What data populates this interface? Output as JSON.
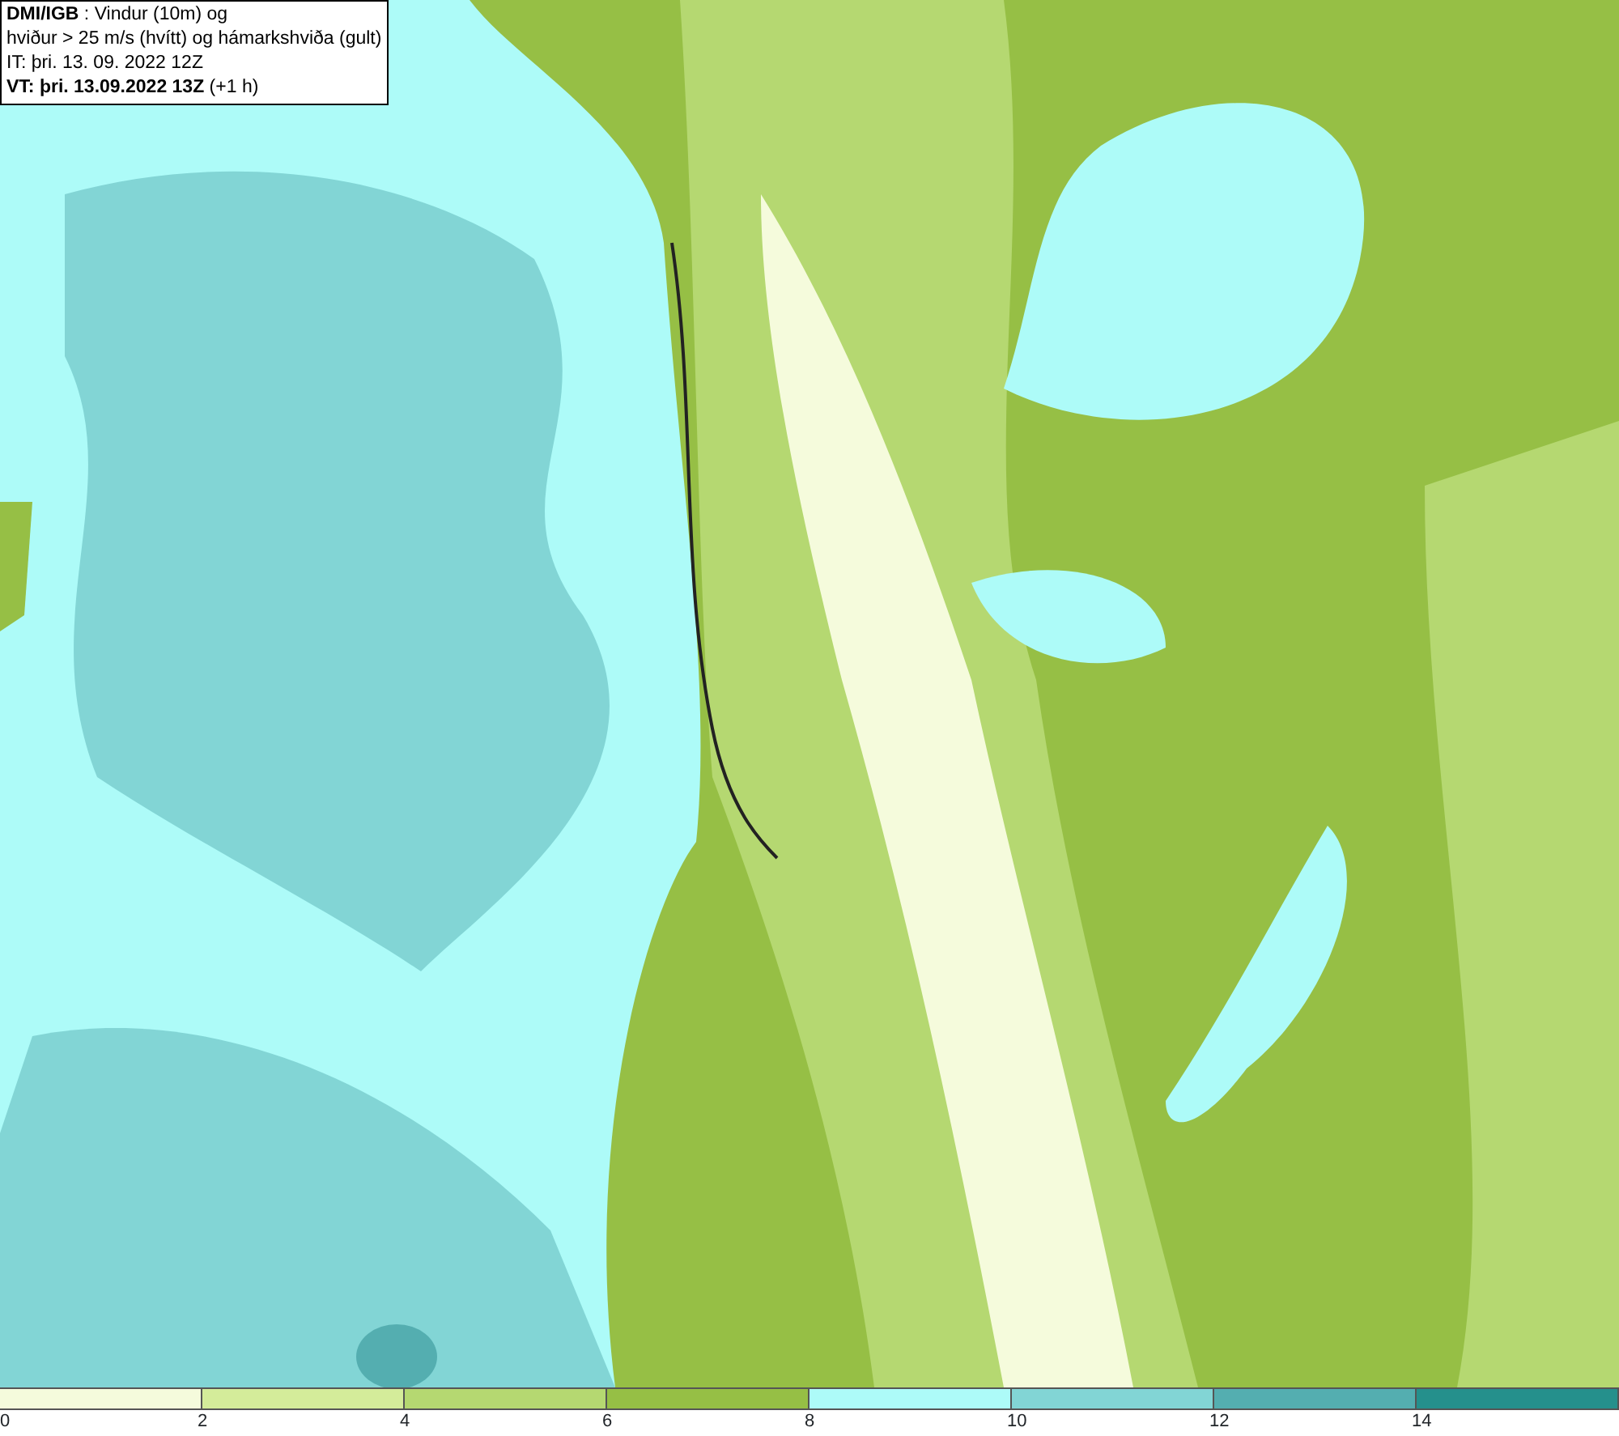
{
  "caption": {
    "lines": [
      "**DMI/IGB** : Vindur (10m) og",
      "hviður > 25 m/s (hvítt) og hámarkshviða (gult)",
      "IT: þri. 13. 09. 2022 12Z",
      "**VT: þri. 13.09.2022 13Z** (+1 h)"
    ]
  },
  "legend": {
    "bins": [
      {
        "color": "#f5fbdc"
      },
      {
        "color": "#d4ec9a"
      },
      {
        "color": "#b5d871"
      },
      {
        "color": "#96bf45"
      },
      {
        "color": "#adfbf8"
      },
      {
        "color": "#82d5d5"
      },
      {
        "color": "#54aeb0"
      },
      {
        "color": "#25908c"
      }
    ],
    "ticks": [
      "0",
      "2",
      "4",
      "6",
      "8",
      "10",
      "12",
      "14"
    ]
  }
}
